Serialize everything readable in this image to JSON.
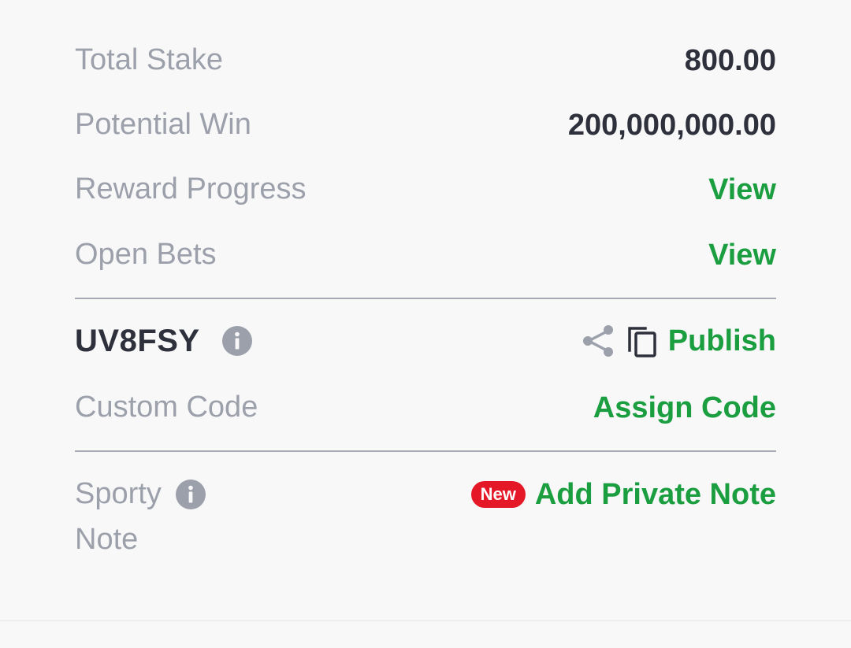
{
  "summary": {
    "total_stake_label": "Total Stake",
    "total_stake_value": "800.00",
    "potential_win_label": "Potential Win",
    "potential_win_value": "200,000,000.00",
    "reward_progress_label": "Reward Progress",
    "reward_progress_link": "View",
    "open_bets_label": "Open Bets",
    "open_bets_link": "View"
  },
  "booking": {
    "code": "UV8FSY",
    "info_icon": "info-icon",
    "share_icon": "share-icon",
    "copy_icon": "copy-icon",
    "publish_label": "Publish",
    "custom_code_label": "Custom Code",
    "assign_code_label": "Assign Code"
  },
  "note": {
    "label_line1": "Sporty",
    "label_line2": "Note",
    "badge": "New",
    "add_note_label": "Add Private Note"
  },
  "colors": {
    "accent_green": "#1a9e3f",
    "badge_red": "#e41827",
    "label_gray": "#9ca0ab",
    "value_dark": "#2e313c"
  }
}
